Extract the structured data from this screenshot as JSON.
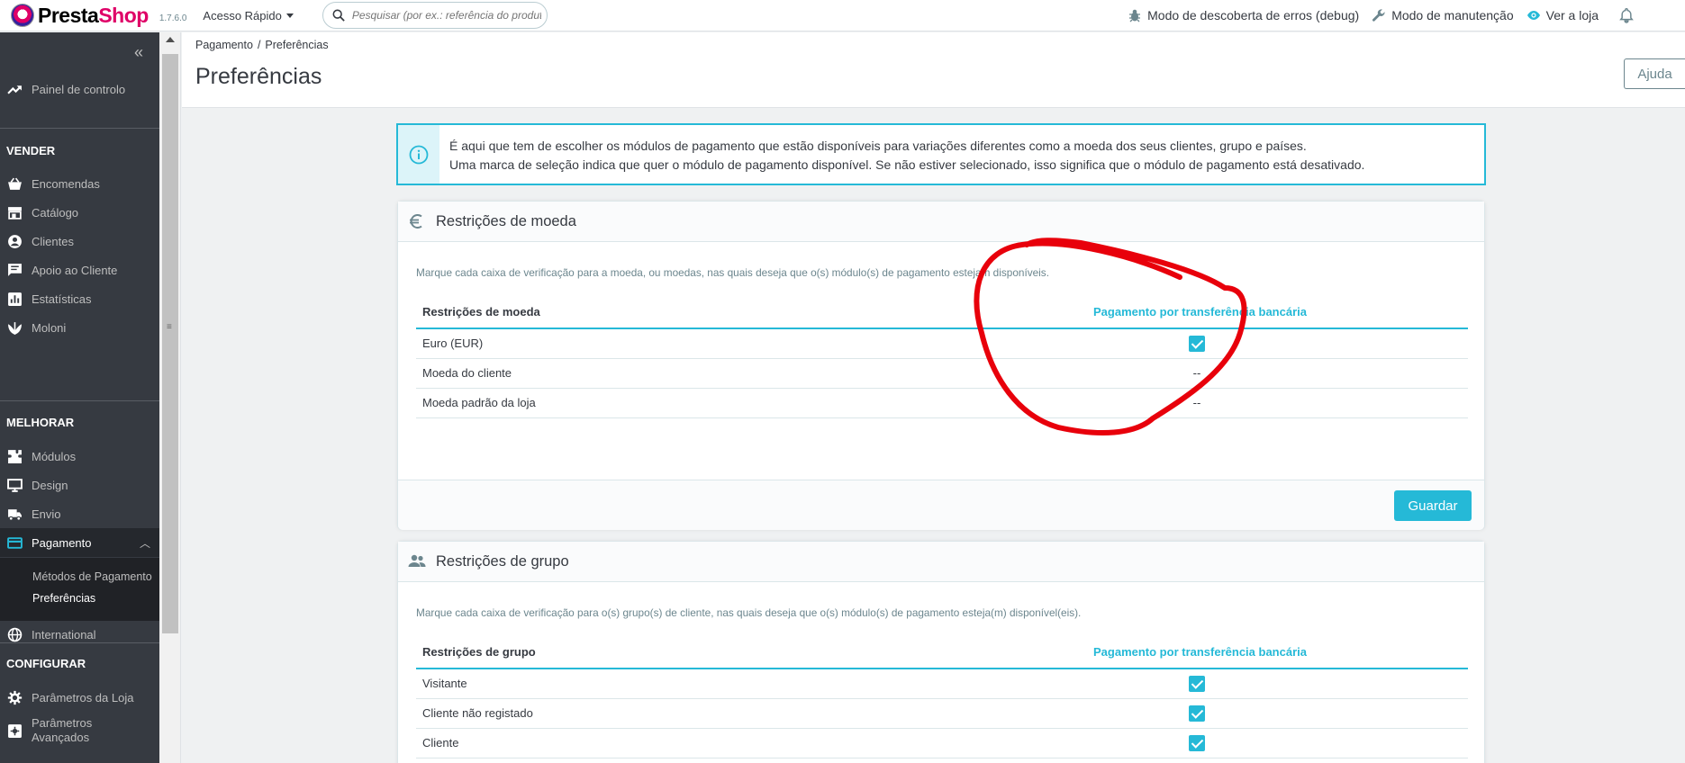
{
  "header": {
    "brand_presta": "Presta",
    "brand_shop": "Shop",
    "version": "1.7.6.0",
    "quick_access": "Acesso Rápido",
    "search_placeholder": "Pesquisar (por ex.: referência do produt",
    "debug_mode": "Modo de descoberta de erros (debug)",
    "maintenance_mode": "Modo de manutenção",
    "view_store": "Ver a loja"
  },
  "sidebar": {
    "dashboard": "Painel de controlo",
    "sections": {
      "sell": "VENDER",
      "improve": "MELHORAR",
      "configure": "CONFIGURAR"
    },
    "sell_items": [
      "Encomendas",
      "Catálogo",
      "Clientes",
      "Apoio ao Cliente",
      "Estatísticas",
      "Moloni"
    ],
    "improve_items": [
      "Módulos",
      "Design",
      "Envio",
      "Pagamento"
    ],
    "payment_sub": [
      "Métodos de Pagamento",
      "Preferências"
    ],
    "international": "International",
    "configure_items": [
      "Parâmetros da Loja",
      "Parâmetros Avançados"
    ]
  },
  "page": {
    "breadcrumb": [
      "Pagamento",
      "Preferências"
    ],
    "breadcrumb_sep": "/",
    "title": "Preferências",
    "help": "Ajuda"
  },
  "alert": {
    "line1": "É aqui que tem de escolher os módulos de pagamento que estão disponíveis para variações diferentes como a moeda dos seus clientes, grupo e países.",
    "line2": "Uma marca de seleção indica que quer o módulo de pagamento disponível. Se não estiver selecionado, isso significa que o módulo de pagamento está desativado."
  },
  "currency_panel": {
    "title": "Restrições de moeda",
    "description": "Marque cada caixa de verificação para a moeda, ou moedas, nas quais deseja que o(s) módulo(s) de pagamento estejam disponíveis.",
    "col_label": "Restrições de moeda",
    "col_module": "Pagamento por transferência bancária",
    "rows": [
      {
        "label": "Euro (EUR)",
        "checked": true,
        "value": ""
      },
      {
        "label": "Moeda do cliente",
        "checked": false,
        "value": "--"
      },
      {
        "label": "Moeda padrão da loja",
        "checked": false,
        "value": "--"
      }
    ],
    "save": "Guardar"
  },
  "group_panel": {
    "title": "Restrições de grupo",
    "description": "Marque cada caixa de verificação para o(s) grupo(s) de cliente, nas quais deseja que o(s) módulo(s) de pagamento esteja(m) disponível(eis).",
    "col_label": "Restrições de grupo",
    "col_module": "Pagamento por transferência bancária",
    "rows": [
      {
        "label": "Visitante",
        "checked": true
      },
      {
        "label": "Cliente não registado",
        "checked": true
      },
      {
        "label": "Cliente",
        "checked": true
      }
    ]
  },
  "colors": {
    "accent": "#25b9d7",
    "sidebar": "#363a41",
    "annotation": "#e8000b"
  }
}
